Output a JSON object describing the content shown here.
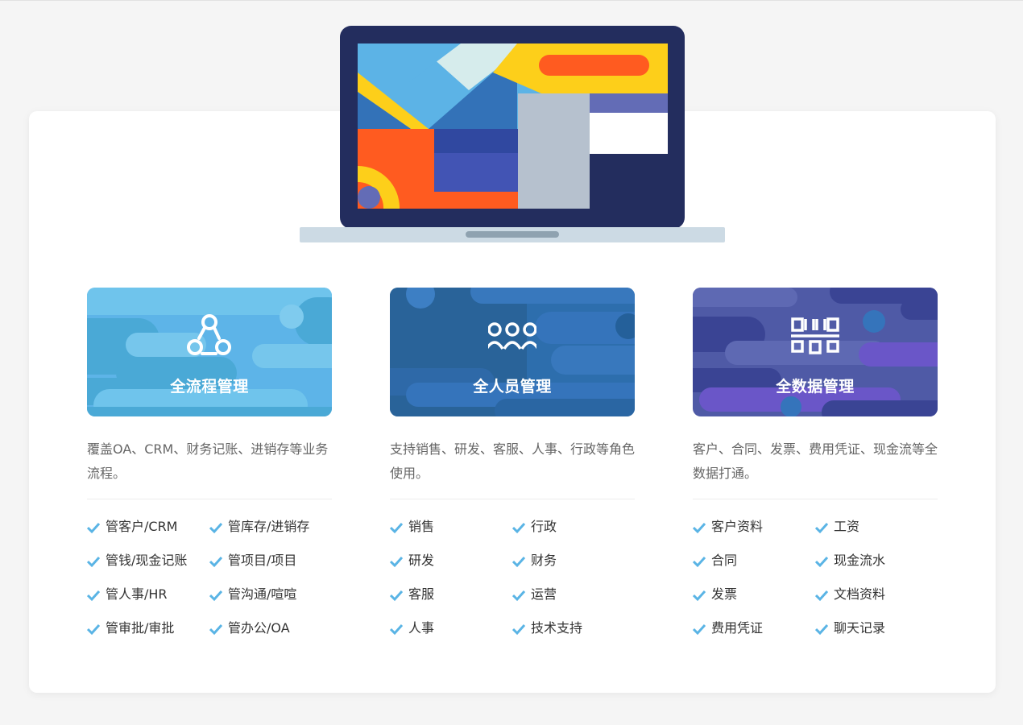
{
  "colors": {
    "page_bg": "#f5f5f5",
    "panel_bg": "#ffffff",
    "check": "#5ab4e5",
    "card_1": "#5db4e8",
    "card_2": "#2d6ead",
    "card_3": "#4f5aa6"
  },
  "cards": [
    {
      "title": "全流程管理",
      "icon": "process-flow-icon",
      "description": "覆盖OA、CRM、财务记账、进销存等业务流程。",
      "features": [
        "管客户/CRM",
        "管库存/进销存",
        "管钱/现金记账",
        "管项目/项目",
        "管人事/HR",
        "管沟通/喧喧",
        "管审批/审批",
        "管办公/OA"
      ]
    },
    {
      "title": "全人员管理",
      "icon": "people-group-icon",
      "description": "支持销售、研发、客服、人事、行政等角色使用。",
      "features": [
        "销售",
        "行政",
        "研发",
        "财务",
        "客服",
        "运营",
        "人事",
        "技术支持"
      ]
    },
    {
      "title": "全数据管理",
      "icon": "data-link-icon",
      "description": "客户、合同、发票、费用凭证、现金流等全数据打通。",
      "features": [
        "客户资料",
        "工资",
        "合同",
        "现金流水",
        "发票",
        "文档资料",
        "费用凭证",
        "聊天记录"
      ]
    }
  ]
}
